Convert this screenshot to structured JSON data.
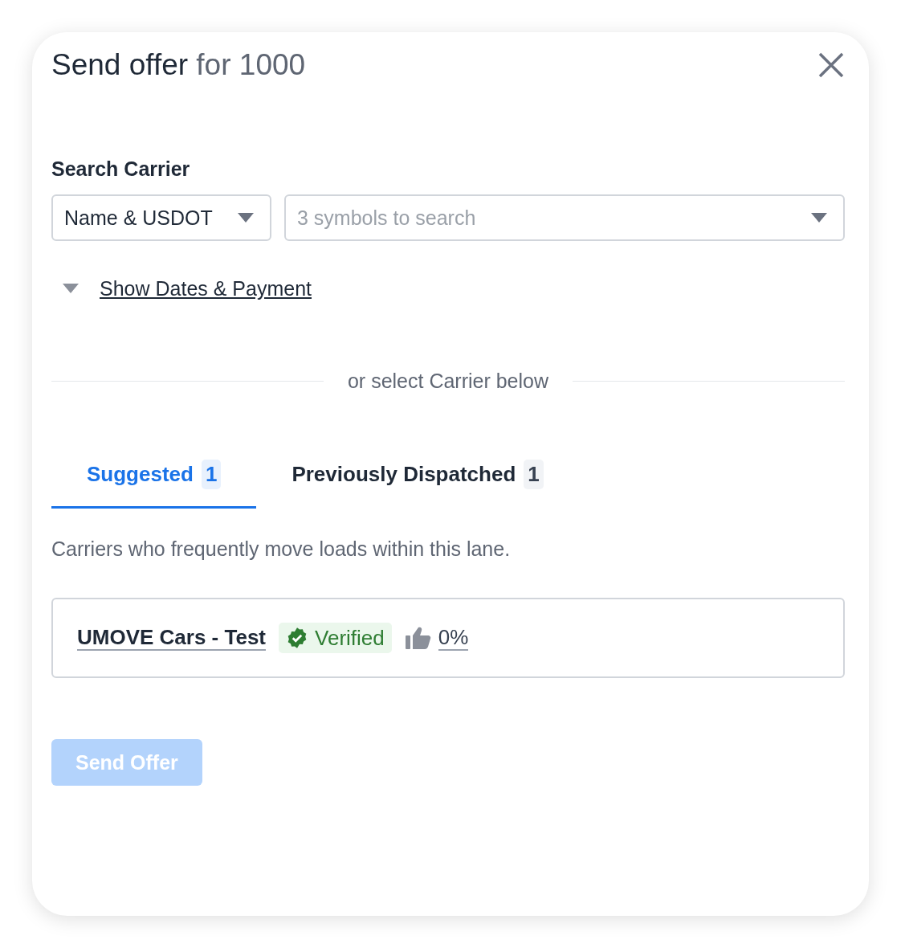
{
  "dialog": {
    "title": "Send offer",
    "title_suffix": "for 1000"
  },
  "search_carrier": {
    "label": "Search Carrier",
    "mode_select": {
      "value": "Name & USDOT"
    },
    "search_field": {
      "placeholder": "3 symbols to search"
    }
  },
  "dates_toggle": {
    "label": "Show Dates & Payment",
    "expanded": false
  },
  "divider_text": "or select Carrier below",
  "tabs": [
    {
      "label": "Suggested",
      "count": "1",
      "selected": true
    },
    {
      "label": "Previously Dispatched",
      "count": "1",
      "selected": false
    }
  ],
  "description": "Carriers who frequently move loads within this lane.",
  "carriers": [
    {
      "name": "UMOVE Cars - Test",
      "verified": true,
      "badge": "Verified",
      "rating": "0%"
    }
  ],
  "send_button": {
    "label": "Send Offer",
    "disabled": true
  }
}
